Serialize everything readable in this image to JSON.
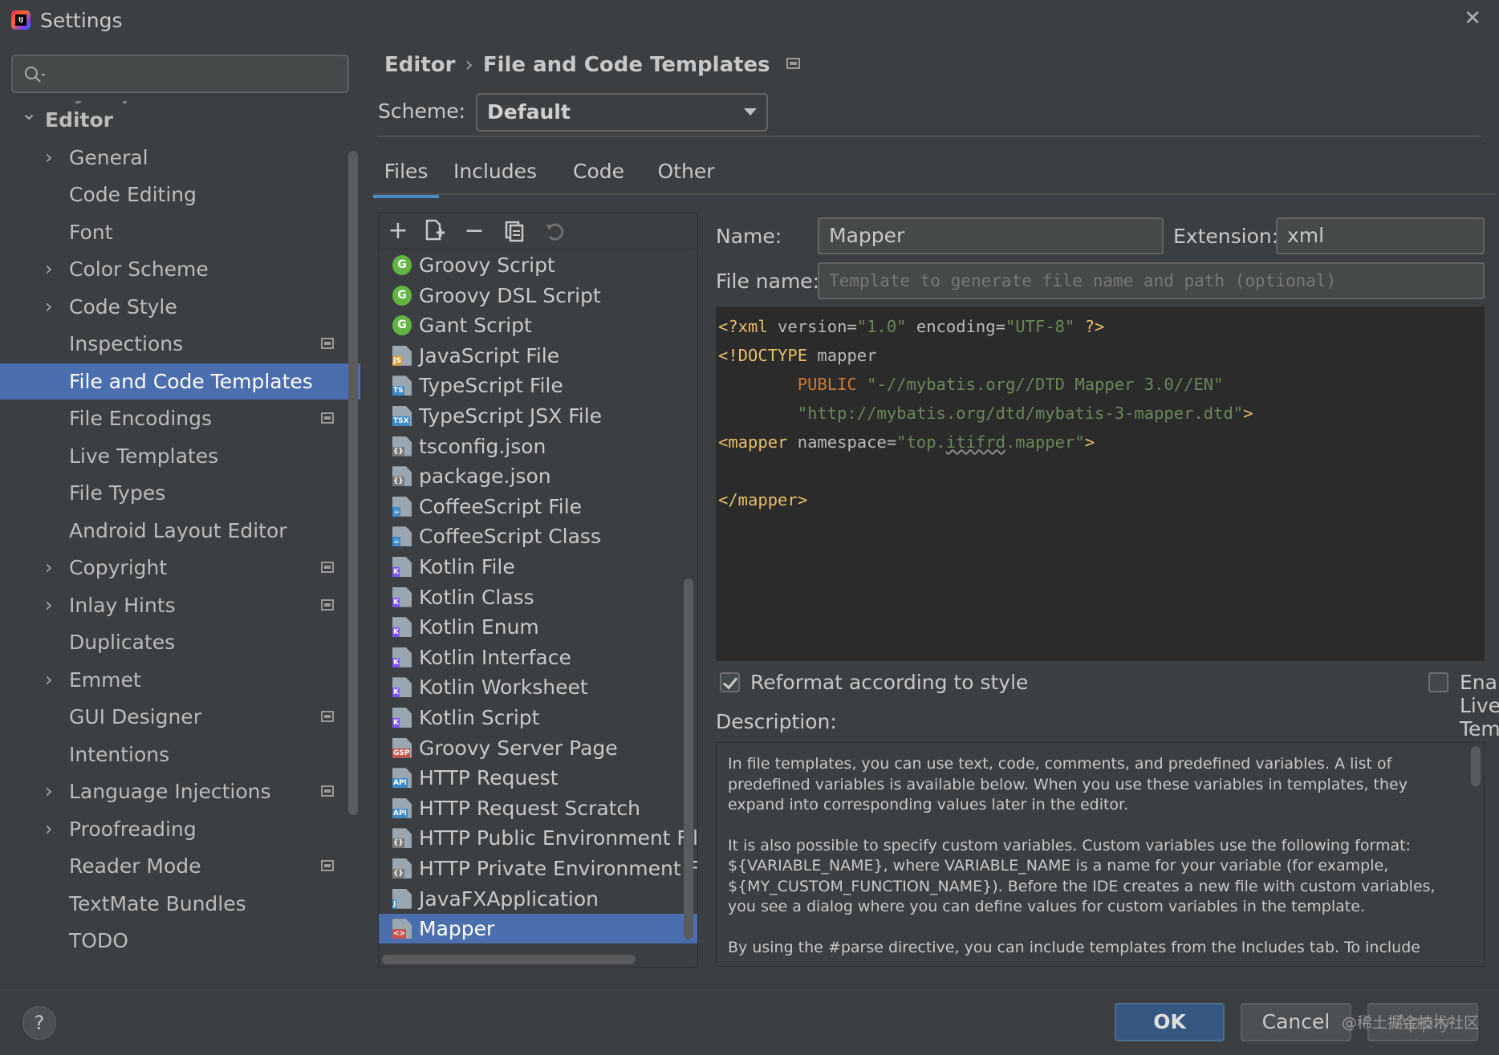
{
  "window": {
    "title": "Settings",
    "app_logo_text": "IJ"
  },
  "sidebar": {
    "search": {
      "value": "",
      "placeholder": ""
    },
    "partial_item": "Keymap",
    "items": [
      {
        "label": "Editor",
        "level": 0,
        "expandable": true,
        "expanded": true
      },
      {
        "label": "General",
        "level": 1,
        "expandable": true
      },
      {
        "label": "Code Editing",
        "level": 1
      },
      {
        "label": "Font",
        "level": 1
      },
      {
        "label": "Color Scheme",
        "level": 1,
        "expandable": true
      },
      {
        "label": "Code Style",
        "level": 1,
        "expandable": true
      },
      {
        "label": "Inspections",
        "level": 1,
        "project_icon": true
      },
      {
        "label": "File and Code Templates",
        "level": 1,
        "selected": true
      },
      {
        "label": "File Encodings",
        "level": 1,
        "project_icon": true
      },
      {
        "label": "Live Templates",
        "level": 1
      },
      {
        "label": "File Types",
        "level": 1
      },
      {
        "label": "Android Layout Editor",
        "level": 1
      },
      {
        "label": "Copyright",
        "level": 1,
        "expandable": true,
        "project_icon": true
      },
      {
        "label": "Inlay Hints",
        "level": 1,
        "expandable": true,
        "project_icon": true
      },
      {
        "label": "Duplicates",
        "level": 1
      },
      {
        "label": "Emmet",
        "level": 1,
        "expandable": true
      },
      {
        "label": "GUI Designer",
        "level": 1,
        "project_icon": true
      },
      {
        "label": "Intentions",
        "level": 1
      },
      {
        "label": "Language Injections",
        "level": 1,
        "expandable": true,
        "project_icon": true
      },
      {
        "label": "Proofreading",
        "level": 1,
        "expandable": true
      },
      {
        "label": "Reader Mode",
        "level": 1,
        "project_icon": true
      },
      {
        "label": "TextMate Bundles",
        "level": 1
      },
      {
        "label": "TODO",
        "level": 1
      }
    ]
  },
  "main": {
    "breadcrumb": {
      "parent": "Editor",
      "separator": "›",
      "current": "File and Code Templates"
    },
    "scheme": {
      "label": "Scheme:",
      "value": "Default"
    },
    "tabs": [
      {
        "label": "Files",
        "active": true
      },
      {
        "label": "Includes"
      },
      {
        "label": "Code"
      },
      {
        "label": "Other"
      }
    ],
    "toolbar": {
      "add": "+",
      "add_child": "add-child",
      "remove": "−",
      "copy": "copy",
      "reset": "reset"
    },
    "templates": [
      {
        "label": "Groovy Script",
        "icon": "groovy-icon"
      },
      {
        "label": "Groovy DSL Script",
        "icon": "groovy-icon"
      },
      {
        "label": "Gant Script",
        "icon": "groovy-icon"
      },
      {
        "label": "JavaScript File",
        "icon": "js-file-icon",
        "badge": "JS",
        "badge_color": "#d8a03b"
      },
      {
        "label": "TypeScript File",
        "icon": "ts-file-icon",
        "badge": "TS",
        "badge_color": "#3c8ac9"
      },
      {
        "label": "TypeScript JSX File",
        "icon": "tsx-file-icon",
        "badge": "TSX",
        "badge_color": "#3c8ac9"
      },
      {
        "label": "tsconfig.json",
        "icon": "json-file-icon",
        "badge": "{}",
        "badge_color": "#7a7a7a"
      },
      {
        "label": "package.json",
        "icon": "json-file-icon",
        "badge": "{}",
        "badge_color": "#7a7a7a"
      },
      {
        "label": "CoffeeScript File",
        "icon": "coffee-file-icon",
        "badge": "☕",
        "badge_color": "#3c8ac9"
      },
      {
        "label": "CoffeeScript Class",
        "icon": "coffee-file-icon",
        "badge": "☕",
        "badge_color": "#3c8ac9"
      },
      {
        "label": "Kotlin File",
        "icon": "kotlin-file-icon",
        "badge": "K",
        "badge_color": "#7f52ff"
      },
      {
        "label": "Kotlin Class",
        "icon": "kotlin-file-icon",
        "badge": "K",
        "badge_color": "#7f52ff"
      },
      {
        "label": "Kotlin Enum",
        "icon": "kotlin-file-icon",
        "badge": "K",
        "badge_color": "#7f52ff"
      },
      {
        "label": "Kotlin Interface",
        "icon": "kotlin-file-icon",
        "badge": "K",
        "badge_color": "#7f52ff"
      },
      {
        "label": "Kotlin Worksheet",
        "icon": "kotlin-file-icon",
        "badge": "K",
        "badge_color": "#7f52ff"
      },
      {
        "label": "Kotlin Script",
        "icon": "kotlin-file-icon",
        "badge": "K",
        "badge_color": "#7f52ff"
      },
      {
        "label": "Groovy Server Page",
        "icon": "gsp-file-icon",
        "badge": "GSP",
        "badge_color": "#c75450"
      },
      {
        "label": "HTTP Request",
        "icon": "http-file-icon",
        "badge": "API",
        "badge_color": "#3c8ac9"
      },
      {
        "label": "HTTP Request Scratch",
        "icon": "http-file-icon",
        "badge": "API",
        "badge_color": "#3c8ac9"
      },
      {
        "label": "HTTP Public Environment File",
        "icon": "json-file-icon",
        "badge": "{}",
        "badge_color": "#7a7a7a"
      },
      {
        "label": "HTTP Private Environment File",
        "icon": "json-file-icon",
        "badge": "{}",
        "badge_color": "#7a7a7a"
      },
      {
        "label": "JavaFXApplication",
        "icon": "java-file-icon",
        "badge": "J",
        "badge_color": "#3c8ac9"
      },
      {
        "label": "Mapper",
        "icon": "xml-file-icon",
        "badge": "<>",
        "badge_color": "#c75450",
        "selected": true
      }
    ],
    "editor": {
      "name_label": "Name:",
      "name_value": "Mapper",
      "extension_label": "Extension:",
      "extension_value": "xml",
      "filename_label": "File name:",
      "filename_value": "",
      "filename_placeholder": "Template to generate file name and path (optional)",
      "reformat_label": "Reformat according to style",
      "reformat_checked": true,
      "live_templates_label": "Enable Live Templates",
      "live_templates_checked": false,
      "description_label": "Description:",
      "description_paragraphs": [
        "In file templates, you can use text, code, comments, and predefined variables. A list of predefined variables is available below. When you use these variables in templates, they expand into corresponding values later in the editor.",
        "It is also possible to specify custom variables. Custom variables use the following format: ${VARIABLE_NAME}, where VARIABLE_NAME is a name for your variable (for example, ${MY_CUSTOM_FUNCTION_NAME}). Before the IDE creates a new file with custom variables, you see a dialog where you can define values for custom variables in the template.",
        "By using the #parse directive, you can include templates from the Includes tab. To include"
      ]
    },
    "code": {
      "l1_a": "<?xml",
      "l1_b": " version=",
      "l1_c": "\"1.0\"",
      "l1_d": " encoding=",
      "l1_e": "\"UTF-8\"",
      "l1_f": " ?>",
      "l2_a": "<!DOCTYPE",
      "l2_b": " mapper",
      "l3_a": "PUBLIC",
      "l3_b": "\"-//mybatis.org//DTD Mapper 3.0//EN\"",
      "l4_a": "\"http://mybatis.org/dtd/mybatis-3-mapper.dtd\"",
      "l4_b": ">",
      "l5_a": "<mapper",
      "l5_b": " namespace=",
      "l5_c": "\"top.",
      "l5_d": "itifrd",
      "l5_e": ".mapper\"",
      "l5_f": ">",
      "l7_a": "</mapper>"
    }
  },
  "footer": {
    "help": "?",
    "ok": "OK",
    "cancel": "Cancel",
    "apply": "Apply",
    "watermark": "@稀土掘金技术社区"
  },
  "colors": {
    "background": "#3c3f41",
    "selection": "#4b6eaf",
    "accent_tab": "#4a88c7",
    "ok_button": "#365880",
    "code_bg": "#2b2b2b",
    "xml_tag": "#e8bf6a",
    "string": "#6a8759",
    "keyword": "#cc7832"
  }
}
